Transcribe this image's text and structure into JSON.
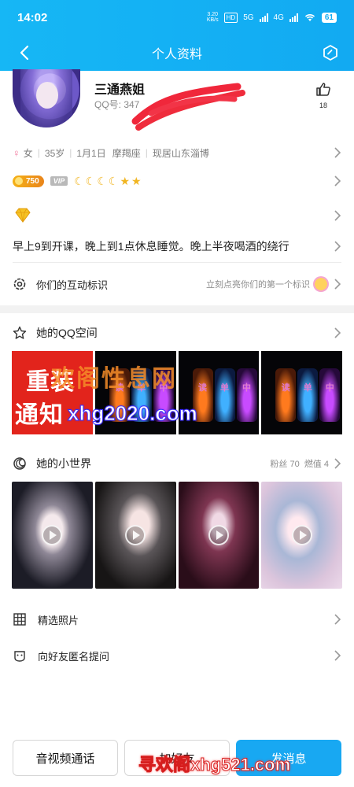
{
  "status_bar": {
    "time": "14:02",
    "net_speed_value": "3.20",
    "net_speed_unit": "KB/s",
    "hd1": "HD",
    "hd2": "HD",
    "net1": "5G",
    "net2": "4G",
    "battery": "61"
  },
  "navbar": {
    "title": "个人资料",
    "icons": [
      "back-arrow-icon",
      "settings-hexagon-icon"
    ]
  },
  "profile": {
    "nickname": "三通燕姐",
    "qq_label": "QQ号: 347",
    "likes": "18",
    "gender": "女",
    "gender_symbol": "♀",
    "age": "35岁",
    "birthday": "1月1日",
    "zodiac": "摩羯座",
    "location": "现居山东淄博",
    "coin_level": "750",
    "vip_label": "VIP",
    "level_icons": [
      "☾",
      "☾",
      "☾",
      "☾",
      "★",
      "★"
    ],
    "signature": "早上9到开课，晚上到1点休息睡觉。晚上半夜喝酒的绕行"
  },
  "interaction": {
    "label": "你们的互动标识",
    "hint": "立刻点亮你们的第一个标识"
  },
  "qzone": {
    "title": "她的QQ空间",
    "tile1_line1": "重装",
    "tile1_line2": "通知",
    "jar_labels": [
      "读",
      "单",
      "中"
    ]
  },
  "world": {
    "title": "她的小世界",
    "fans": "粉丝 70",
    "heat": "燃值 4"
  },
  "photos": {
    "label": "精选照片"
  },
  "anon": {
    "label": "向好友匿名提问"
  },
  "bottom": {
    "call": "音视频通话",
    "add": "加好友",
    "message": "发消息"
  },
  "watermarks": {
    "w1": "欢阁性息网",
    "w2": "xhg2020.com",
    "w3": "寻欢阁xhg521.com"
  },
  "colors": {
    "accent": "#12aaf2",
    "female": "#f2779d",
    "coin": "#f5b217"
  }
}
